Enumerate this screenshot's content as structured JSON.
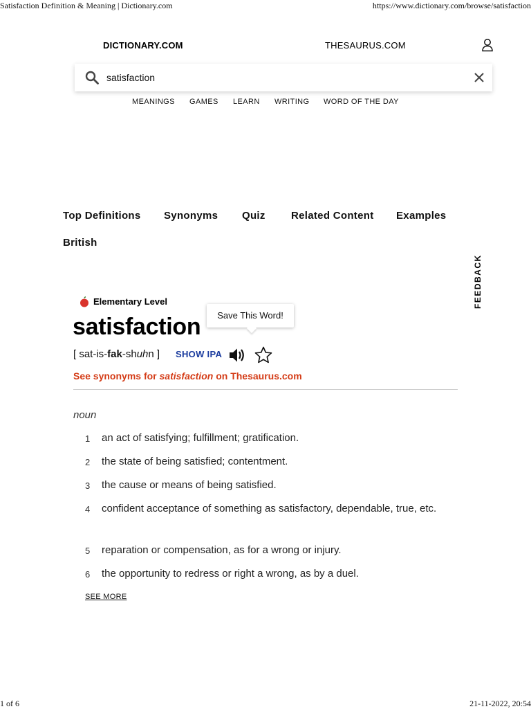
{
  "print_header": {
    "title": "Satisfaction Definition & Meaning | Dictionary.com",
    "url": "https://www.dictionary.com/browse/satisfaction"
  },
  "header": {
    "brand": "DICTIONARY.COM",
    "thesaurus": "THESAURUS.COM",
    "account_icon": "user-icon"
  },
  "search": {
    "value": "satisfaction",
    "search_icon": "search-icon",
    "clear_icon": "close-icon"
  },
  "nav": {
    "items": [
      "MEANINGS",
      "GAMES",
      "LEARN",
      "WRITING",
      "WORD OF THE DAY"
    ]
  },
  "tabs": [
    "Top Definitions",
    "Synonyms",
    "Quiz",
    "Related Content",
    "Examples",
    "British"
  ],
  "feedback": "FEEDBACK",
  "entry": {
    "level_icon": "apple-icon",
    "level": "Elementary Level",
    "headword": "satisfaction",
    "tooltip": "Save This Word!",
    "pron_open": "[ sat-is-",
    "pron_stress": "fak",
    "pron_mid": "-sh",
    "pron_schwa": "uh",
    "pron_close": "n ]",
    "show_ipa": "SHOW IPA",
    "audio_icon": "speaker-icon",
    "save_icon": "star-icon",
    "synonyms_prefix": "See synonyms for ",
    "synonyms_word": "satisfaction",
    "synonyms_suffix": " on Thesaurus.com",
    "part_of_speech": "noun",
    "definitions": [
      {
        "num": "1",
        "text": "an act of satisfying; fulfillment; gratification."
      },
      {
        "num": "2",
        "text": "the state of being satisfied; contentment."
      },
      {
        "num": "3",
        "text": "the cause or means of being satisfied."
      },
      {
        "num": "4",
        "text": "confident acceptance of something as satisfactory, dependable, true, etc."
      },
      {
        "num": "5",
        "text": "reparation or compensation, as for a wrong or injury."
      },
      {
        "num": "6",
        "text": "the opportunity to redress or right a wrong, as by a duel."
      }
    ],
    "see_more": "SEE MORE"
  },
  "footer": {
    "page": "1 of 6",
    "datetime": "21-11-2022, 20:54"
  },
  "colors": {
    "link_blue": "#1a3b9e",
    "thesaurus_orange": "#d43c17"
  }
}
